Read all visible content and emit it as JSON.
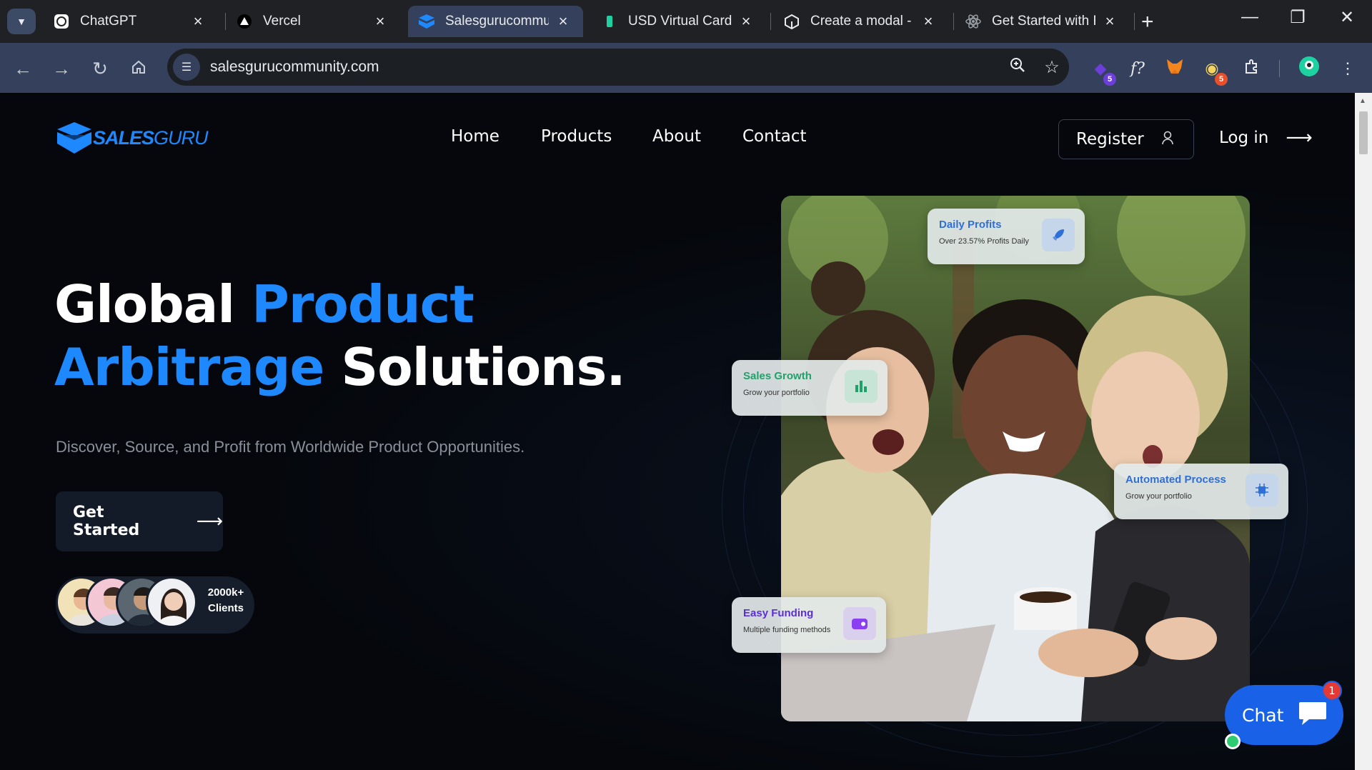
{
  "browser": {
    "tabs": [
      {
        "title": "ChatGPT",
        "icon": "chatgpt-icon"
      },
      {
        "title": "Vercel",
        "icon": "vercel-icon"
      },
      {
        "title": "Salesgurucommun",
        "icon": "salesguru-icon",
        "active": true
      },
      {
        "title": "USD Virtual Cards",
        "icon": "card-icon"
      },
      {
        "title": "Create a modal - E",
        "icon": "codesandbox-icon"
      },
      {
        "title": "Get Started with Re",
        "icon": "react-icon"
      }
    ],
    "url": "salesgurucommunity.com",
    "extensions": [
      {
        "icon": "puzzle-badge-icon",
        "badge": "5",
        "badge_color": "#6b3fd8"
      },
      {
        "icon": "formula-icon"
      },
      {
        "icon": "metamask-fox-icon"
      },
      {
        "icon": "bulb-icon",
        "badge": "5",
        "badge_color": "#e8502b"
      },
      {
        "icon": "extensions-icon"
      }
    ]
  },
  "site": {
    "brand": {
      "part1": "SALES",
      "part2": "GURU"
    },
    "nav": [
      "Home",
      "Products",
      "About",
      "Contact"
    ],
    "register_label": "Register",
    "login_label": "Log in",
    "headline": {
      "w1": "Global",
      "w2": "Product",
      "w3": "Arbitrage",
      "w4": "Solutions."
    },
    "subtitle": "Discover, Source, and Profit from Worldwide Product Opportunities.",
    "cta_label": "Get Started",
    "clients": {
      "count": "2000k+",
      "label": "Clients"
    },
    "cards": [
      {
        "title": "Daily Profits",
        "subtitle": "Over 23.57% Profits Daily",
        "color": "#2f6fd8",
        "icon": "rocket-icon"
      },
      {
        "title": "Sales Growth",
        "subtitle": "Grow your portfolio",
        "color": "#22a06b",
        "icon": "bar-chart-icon"
      },
      {
        "title": "Automated Process",
        "subtitle": "Grow your portfolio",
        "color": "#2f6fd8",
        "icon": "chip-icon"
      },
      {
        "title": "Easy Funding",
        "subtitle": "Multiple funding methods",
        "color": "#5b2fd8",
        "icon": "wallet-icon"
      }
    ],
    "chat": {
      "label": "Chat",
      "notifications": "1"
    }
  },
  "colors": {
    "accent": "#1e88ff",
    "background": "#05070c",
    "chat": "#1962e8"
  }
}
